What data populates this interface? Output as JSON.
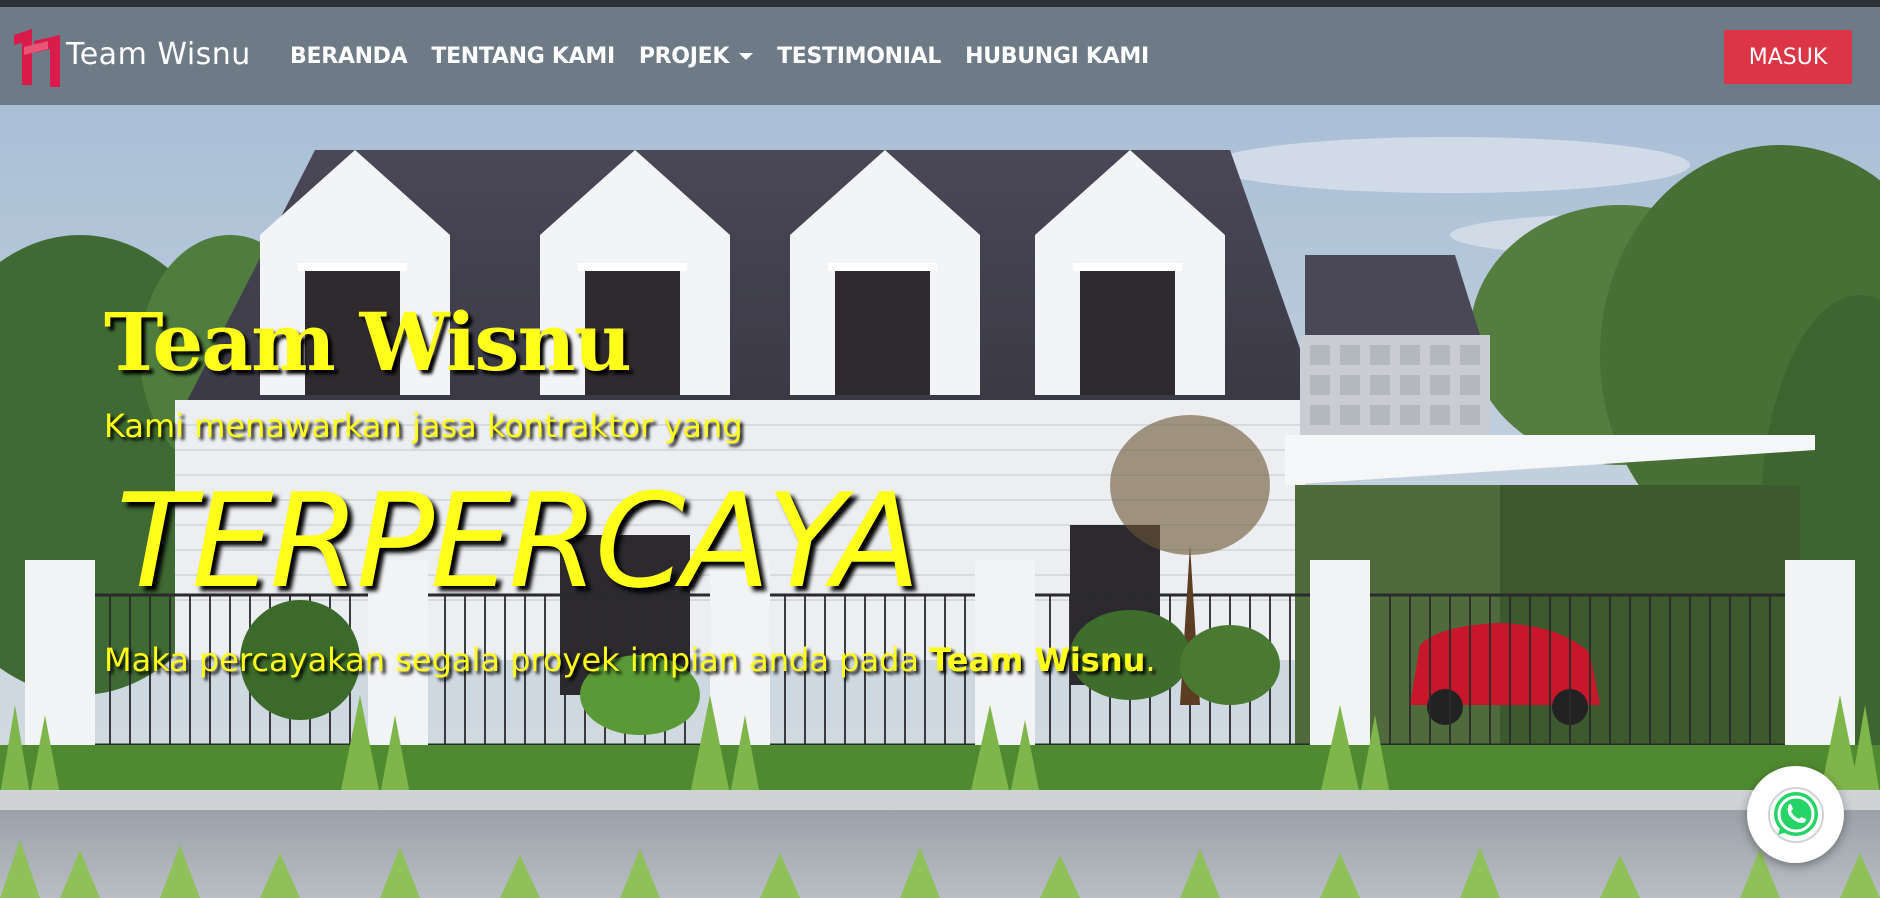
{
  "brand": {
    "name": "Team Wisnu",
    "logo_icon": "tw-logo-icon",
    "logo_color": "#d81b4a"
  },
  "nav": {
    "items": [
      {
        "label": "BERANDA"
      },
      {
        "label": "TENTANG KAMI"
      },
      {
        "label": "PROJEK",
        "dropdown": true
      },
      {
        "label": "TESTIMONIAL"
      },
      {
        "label": "HUBUNGI KAMI"
      }
    ]
  },
  "login_button": {
    "label": "MASUK",
    "color": "#dc3545"
  },
  "hero": {
    "title": "Team Wisnu",
    "subtitle": "Kami menawarkan jasa kontraktor yang",
    "highlight": "TERPERCAYA",
    "line_prefix": "Maka percayakan segala proyek impian anda pada ",
    "line_brand": "Team Wisnu",
    "line_suffix": ".",
    "text_color": "#ffff1a"
  },
  "whatsapp": {
    "icon": "whatsapp-icon",
    "color": "#25d366"
  },
  "theme": {
    "navbar_bg": "#6e7b86"
  }
}
